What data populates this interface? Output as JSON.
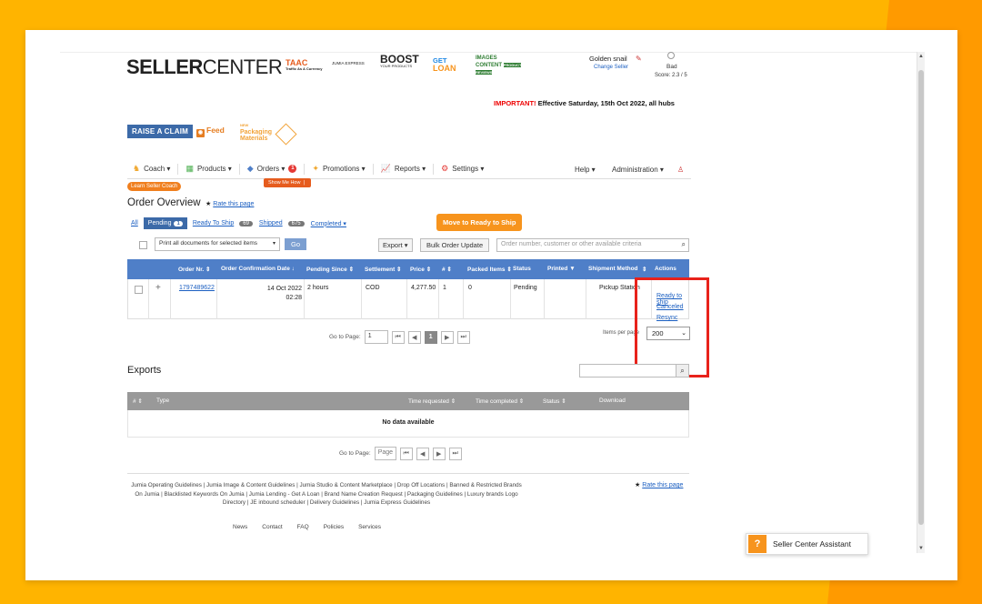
{
  "header": {
    "logo_bold": "SELLER",
    "logo_light": "CENTER",
    "brands": [
      "TAAC",
      "Traffic As A Currency",
      "JUMIA EXPRESS",
      "BOOST",
      "YOUR PRODUCTS",
      "GET",
      "LOAN",
      "IMAGES CONTENT",
      "PRODUCT REVIEWS"
    ],
    "user_name": "Golden snail",
    "change_seller": "Change Seller",
    "score_label": "Bad",
    "score_value": "Score: 2.3 / 5"
  },
  "notice": {
    "important": "IMPORTANT!",
    "text": "Effective Saturday, 15th Oct 2022, all hubs"
  },
  "actions_bar": {
    "raise_claim": "RAISE A CLAIM",
    "feed": "Feed",
    "packaging_top": "Packaging",
    "packaging_bottom": "Materials",
    "packaging_new": "NEW"
  },
  "nav": {
    "coach": "Coach ▾",
    "products": "Products ▾",
    "orders": "Orders ▾",
    "orders_badge": "1",
    "promotions": "Promotions ▾",
    "reports": "Reports ▾",
    "settings": "Settings ▾",
    "help": "Help ▾",
    "administration": "Administration ▾",
    "learn_coach": "Learn Seller Coach",
    "show_me_how": "Show Me How"
  },
  "page": {
    "title": "Order Overview",
    "rate": "Rate this page"
  },
  "tabs": {
    "all": "All",
    "pending": "Pending",
    "pending_count": "1",
    "ready": "Ready To Ship",
    "ready_count": "69",
    "shipped": "Shipped",
    "shipped_count": "675",
    "completed": "Completed ▾"
  },
  "move_button": "Move to Ready to Ship",
  "toolbar": {
    "print_select": "Print all documents for selected items",
    "go": "Go",
    "export": "Export ▾",
    "bulk": "Bulk Order Update",
    "search_placeholder": "Order number, customer or other available criteria"
  },
  "table": {
    "headers": [
      "Order Nr.",
      "Order Confirmation Date",
      "Pending Since",
      "Settlement",
      "Price",
      "#",
      "Packed Items",
      "Status",
      "Printed",
      "Shipment Method",
      "Actions"
    ],
    "row": {
      "order_nr": "1797489622",
      "date_line1": "14 Oct 2022",
      "date_line2": "02:28",
      "pending_since": "2 hours",
      "settlement": "COD",
      "price": "4,277.50",
      "count": "1",
      "packed": "0",
      "status": "Pending",
      "shipment": "Pickup Station",
      "actions": [
        "Ready to ship",
        "Canceled",
        "Resync"
      ]
    }
  },
  "pagination": {
    "go_to_page": "Go to Page:",
    "page_value": "1",
    "current": "1",
    "items_per_page": "Items per page",
    "ipp_value": "200"
  },
  "exports": {
    "title": "Exports",
    "headers": [
      "#",
      "Type",
      "Time requested",
      "Time completed",
      "Status",
      "Download"
    ],
    "empty": "No data available",
    "go_to_page": "Go to Page:",
    "page_placeholder": "Page"
  },
  "footer": {
    "text": "Jumia Operating Guidelines | Jumia Image & Content Guidelines | Jumia Studio & Content Marketplace | Drop Off Locations | Banned & Restricted Brands On Jumia | Blacklisted Keywords On Jumia | Jumia Lending - Get A Loan | Brand Name Creation Request | Packaging Guidelines | Luxury brands Logo Directory | JE inbound scheduler | Delivery Guidelines | Jumia Express Guidelines",
    "rate": "Rate this page",
    "links": [
      "News",
      "Contact",
      "FAQ",
      "Policies",
      "Services"
    ]
  },
  "assistant": {
    "icon": "?",
    "label": "Seller Center Assistant"
  },
  "colors": {
    "background": "#FFB400",
    "accent_blue": "#4f7fc8",
    "orange": "#f7941d",
    "highlight": "#e8221b"
  }
}
